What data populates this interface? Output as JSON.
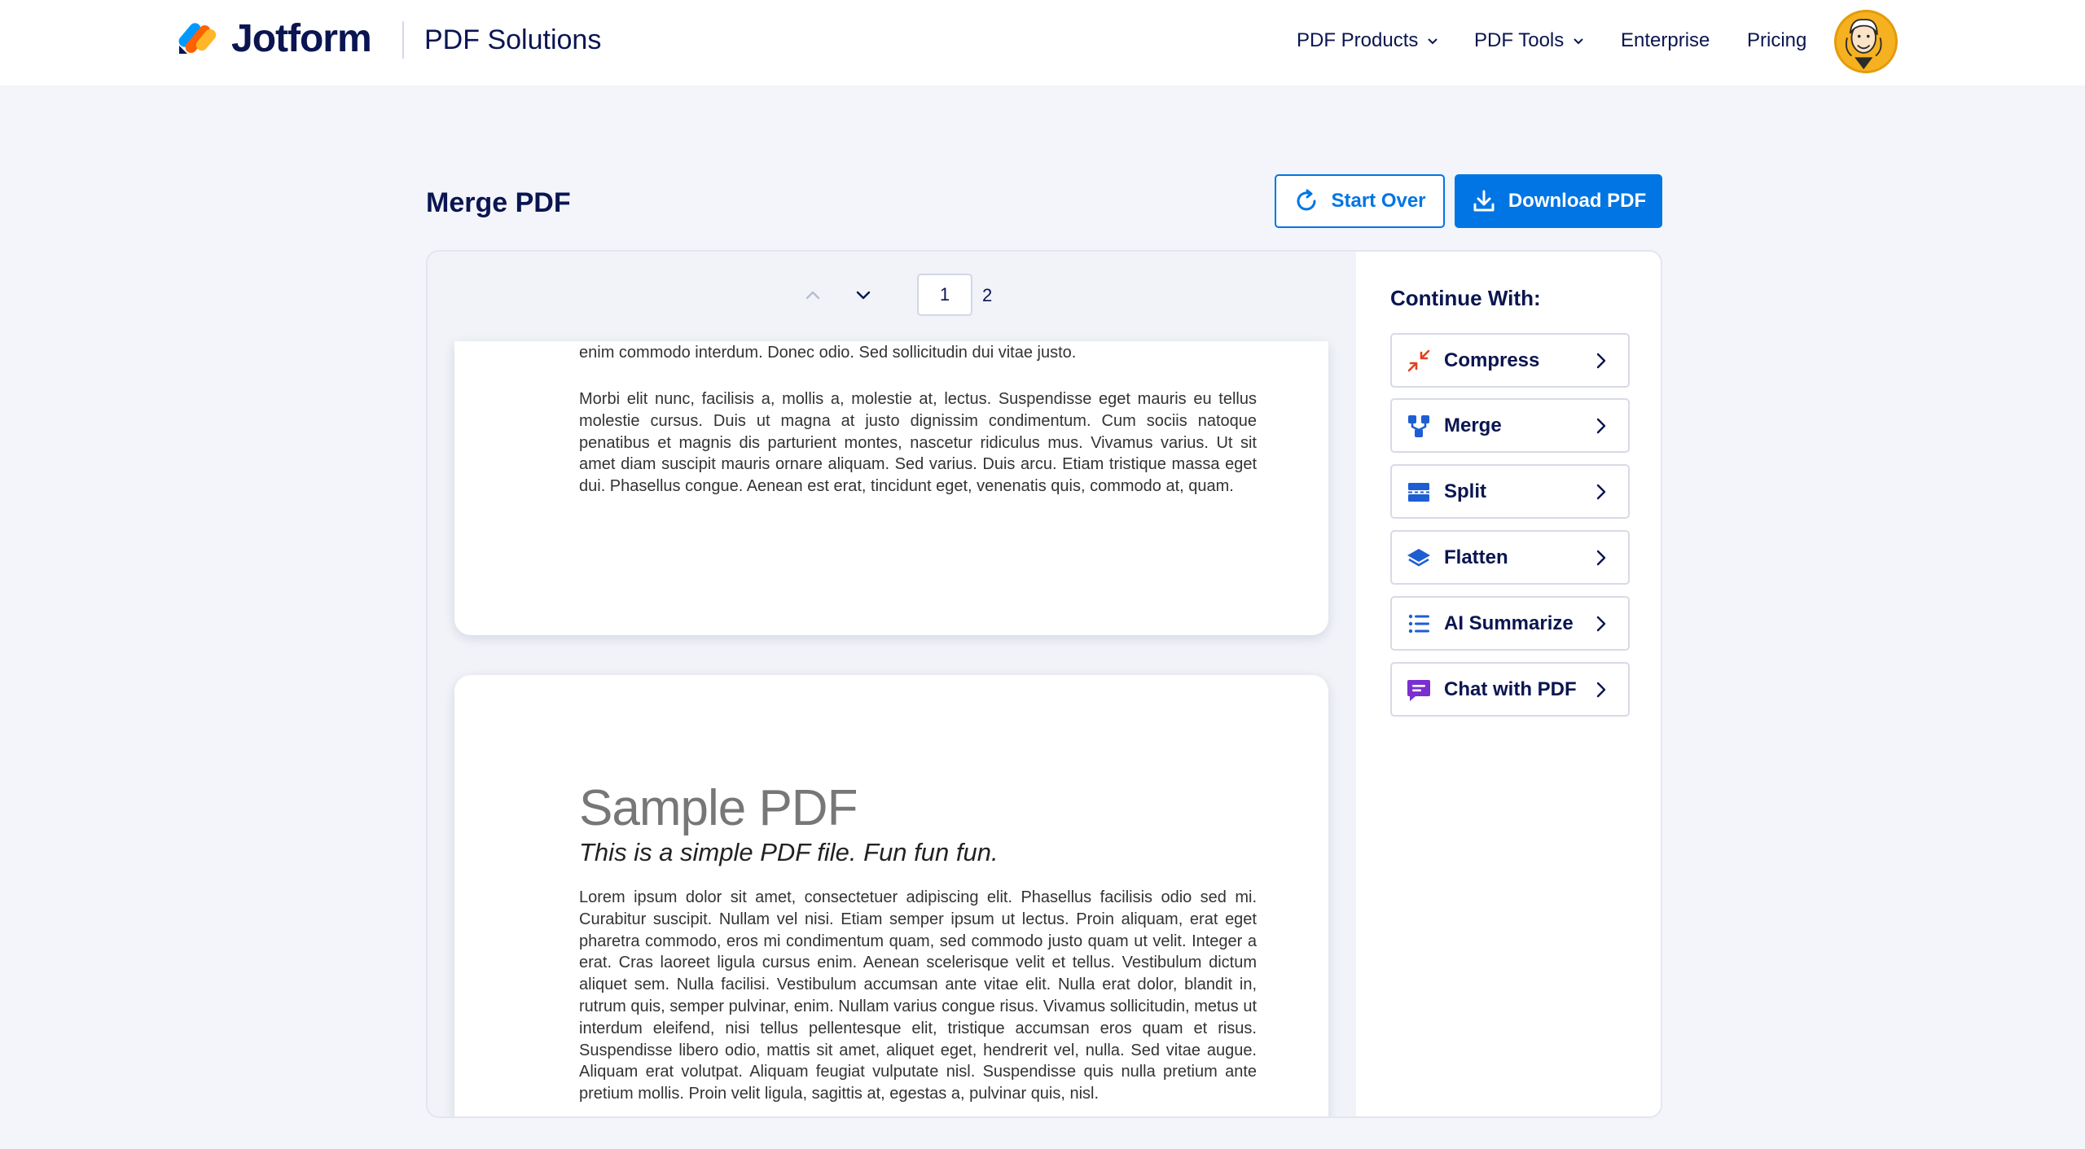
{
  "header": {
    "brand": "Jotform",
    "subbrand": "PDF Solutions",
    "nav": [
      {
        "label": "PDF Products",
        "has_dropdown": true
      },
      {
        "label": "PDF Tools",
        "has_dropdown": true
      },
      {
        "label": "Enterprise",
        "has_dropdown": false
      },
      {
        "label": "Pricing",
        "has_dropdown": false
      }
    ],
    "avatar_icon": "user-avatar"
  },
  "page": {
    "title": "Merge PDF",
    "start_over_label": "Start Over",
    "download_label": "Download PDF"
  },
  "viewer": {
    "current_page": "1",
    "total_pages": "2",
    "page1": {
      "line": "enim commodo interdum. Donec odio. Sed sollicitudin dui vitae justo.",
      "paragraph": "Morbi elit nunc, facilisis a, mollis a, molestie at, lectus. Suspendisse eget mauris eu tellus molestie cursus. Duis ut magna at justo dignissim condimentum. Cum sociis natoque penatibus et magnis dis parturient montes, nascetur ridiculus mus. Vivamus varius. Ut sit amet diam suscipit mauris ornare aliquam. Sed varius. Duis arcu. Etiam tristique massa eget dui. Phasellus congue. Aenean est erat, tincidunt eget, venenatis quis, commodo at, quam."
    },
    "page2": {
      "title": "Sample PDF",
      "subtitle": "This is a simple PDF file. Fun fun fun.",
      "paragraph": "Lorem ipsum dolor sit amet, consectetuer adipiscing elit. Phasellus facilisis odio sed mi. Curabitur suscipit. Nullam vel nisi. Etiam semper ipsum ut lectus. Proin aliquam, erat eget pharetra commodo, eros mi condimentum quam, sed commodo justo quam ut velit. Integer a erat. Cras laoreet ligula cursus enim. Aenean scelerisque velit et tellus. Vestibulum dictum aliquet sem. Nulla facilisi. Vestibulum accumsan ante vitae elit. Nulla erat dolor, blandit in, rutrum quis, semper pulvinar, enim. Nullam varius congue risus. Vivamus sollicitudin, metus ut interdum eleifend, nisi tellus pellentesque elit, tristique accumsan eros quam et risus. Suspendisse libero odio, mattis sit amet, aliquet eget, hendrerit vel, nulla. Sed vitae augue. Aliquam erat volutpat. Aliquam feugiat vulputate nisl. Suspendisse quis nulla pretium ante pretium mollis. Proin velit ligula, sagittis at, egestas a, pulvinar quis, nisl."
    }
  },
  "sidebar": {
    "title": "Continue With:",
    "tools": [
      {
        "label": "Compress",
        "icon": "compress-icon",
        "color": "#e2421c"
      },
      {
        "label": "Merge",
        "icon": "merge-icon",
        "color": "#1e5ed3"
      },
      {
        "label": "Split",
        "icon": "split-icon",
        "color": "#1e5ed3"
      },
      {
        "label": "Flatten",
        "icon": "flatten-icon",
        "color": "#1e5ed3"
      },
      {
        "label": "AI Summarize",
        "icon": "list-icon",
        "color": "#1e5ed3"
      },
      {
        "label": "Chat with PDF",
        "icon": "chat-icon",
        "color": "#7a2fd0"
      }
    ]
  },
  "colors": {
    "accent": "#0075e3",
    "navy": "#0a1551",
    "background": "#f3f5fa"
  }
}
